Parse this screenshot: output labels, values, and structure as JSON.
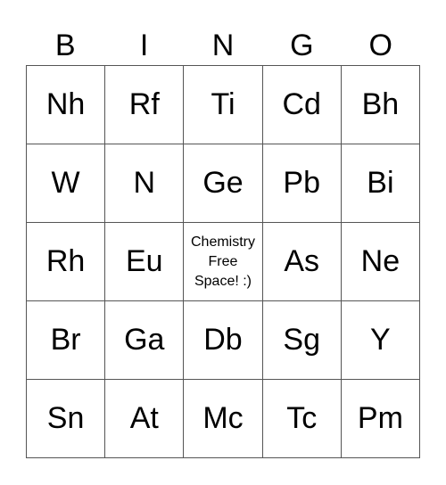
{
  "header": [
    "B",
    "I",
    "N",
    "G",
    "O"
  ],
  "cells": [
    "Nh",
    "Rf",
    "Ti",
    "Cd",
    "Bh",
    "W",
    "N",
    "Ge",
    "Pb",
    "Bi",
    "Rh",
    "Eu",
    "Chemistry\nFree\nSpace! :)",
    "As",
    "Ne",
    "Br",
    "Ga",
    "Db",
    "Sg",
    "Y",
    "Sn",
    "At",
    "Mc",
    "Tc",
    "Pm"
  ]
}
